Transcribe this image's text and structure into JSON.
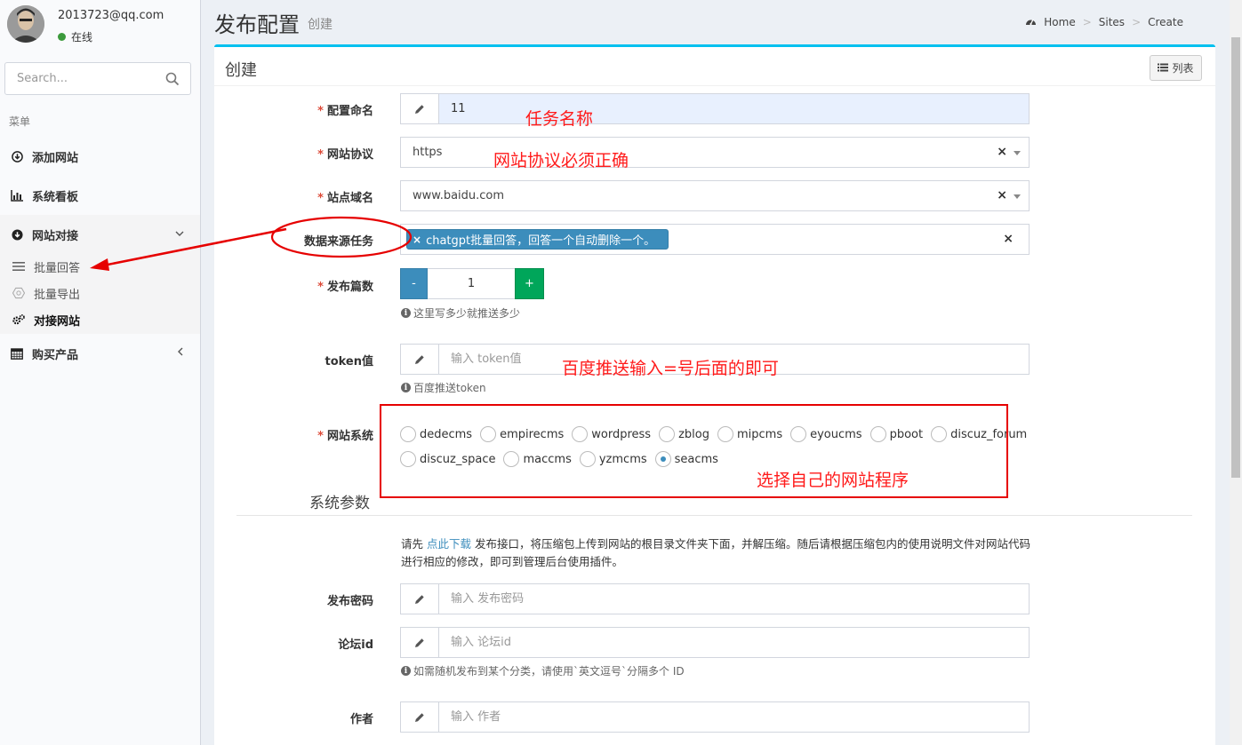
{
  "user": {
    "email": "2013723@qq.com",
    "status": "在线"
  },
  "sidebar": {
    "search_placeholder": "Search...",
    "menu_header": "菜单",
    "items": [
      {
        "label": "添加网站",
        "icon": "download-circle-icon"
      },
      {
        "label": "系统看板",
        "icon": "bar-chart-icon"
      },
      {
        "label": "网站对接",
        "icon": "download-circle-icon",
        "open": true
      },
      {
        "label": "购买产品",
        "icon": "calendar-icon"
      }
    ],
    "submenu": [
      {
        "label": "批量回答",
        "icon": "list-icon"
      },
      {
        "label": "批量导出",
        "icon": "hexagon-icon"
      },
      {
        "label": "对接网站",
        "icon": "cogs-icon",
        "active": true
      }
    ]
  },
  "header": {
    "title": "发布配置",
    "subtitle": "创建",
    "breadcrumb": [
      "Home",
      "Sites",
      "Create"
    ]
  },
  "box": {
    "title": "创建",
    "list_button": "列表"
  },
  "form": {
    "name": {
      "label": "配置命名",
      "value": "11",
      "required": true
    },
    "protocol": {
      "label": "网站协议",
      "value": "https",
      "required": true
    },
    "domain": {
      "label": "站点域名",
      "value": "www.baidu.com",
      "required": true
    },
    "source": {
      "label": "数据来源任务",
      "tag": "chatgpt批量回答，回答一个自动删除一个。"
    },
    "count": {
      "label": "发布篇数",
      "value": "1",
      "minus": "-",
      "plus": "+",
      "help": "这里写多少就推送多少",
      "required": true
    },
    "token": {
      "label": "token值",
      "placeholder": "输入 token值",
      "help": "百度推送token"
    },
    "system": {
      "label": "网站系统",
      "required": true,
      "options_row1": [
        "dedecms",
        "empirecms",
        "wordpress",
        "zblog",
        "mipcms",
        "eyoucms",
        "pboot",
        "discuz_forum"
      ],
      "options_row2": [
        "discuz_space",
        "maccms",
        "yzmcms",
        "seacms"
      ],
      "selected": "seacms"
    },
    "section_title": "系统参数",
    "notice_prefix": "请先 ",
    "notice_link": "点此下载",
    "notice_rest": " 发布接口，将压缩包上传到网站的根目录文件夹下面，并解压缩。随后请根据压缩包内的使用说明文件对网站代码进行相应的修改，即可到管理后台使用插件。",
    "password": {
      "label": "发布密码",
      "placeholder": "输入 发布密码"
    },
    "forum_id": {
      "label": "论坛id",
      "placeholder": "输入 论坛id",
      "help": "如需随机发布到某个分类，请使用`英文逗号`分隔多个 ID"
    },
    "author": {
      "label": "作者",
      "placeholder": "输入 作者"
    }
  },
  "annotations": {
    "task_name": "任务名称",
    "protocol_note": "网站协议必须正确",
    "token_note": "百度推送输入=号后面的即可",
    "system_note": "选择自己的网站程序",
    "color": "#ff1a1a"
  }
}
